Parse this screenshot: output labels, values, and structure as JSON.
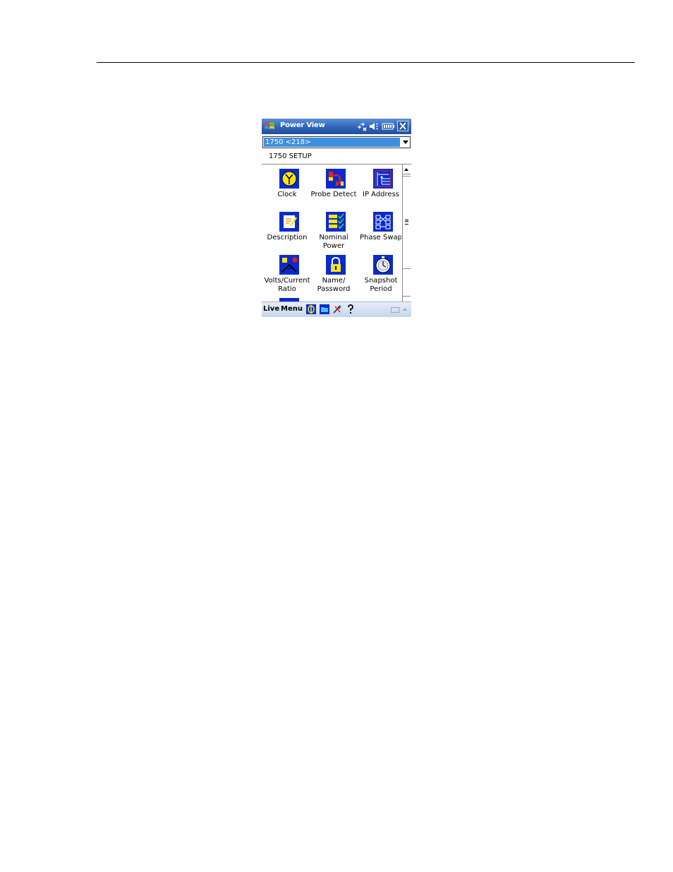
{
  "app": {
    "title": "Power View",
    "status_icons": [
      "connectivity-icon",
      "speaker-icon",
      "battery-icon",
      "close-icon"
    ]
  },
  "device_select": {
    "value": "1750 <218>"
  },
  "section_title": "1750 SETUP",
  "tiles": [
    {
      "label": "Clock",
      "icon": "clock-icon"
    },
    {
      "label": "Probe Detect",
      "icon": "probe-detect-icon"
    },
    {
      "label": "IP Address",
      "icon": "ip-address-icon"
    },
    {
      "label": "Description",
      "icon": "description-icon"
    },
    {
      "label": "Nominal Power",
      "icon": "nominal-power-icon"
    },
    {
      "label": "Phase Swap",
      "icon": "phase-swap-icon"
    },
    {
      "label": "Volts/Current Ratio",
      "icon": "volts-current-ratio-icon"
    },
    {
      "label": "Name/ Password",
      "icon": "name-password-icon"
    },
    {
      "label": "Snapshot Period",
      "icon": "snapshot-period-icon"
    }
  ],
  "menubar": {
    "left_label": "Live",
    "right_label": "Menu",
    "icons": [
      "phase-icon",
      "folder-icon",
      "tools-icon",
      "help-icon",
      "keyboard-icon"
    ]
  }
}
